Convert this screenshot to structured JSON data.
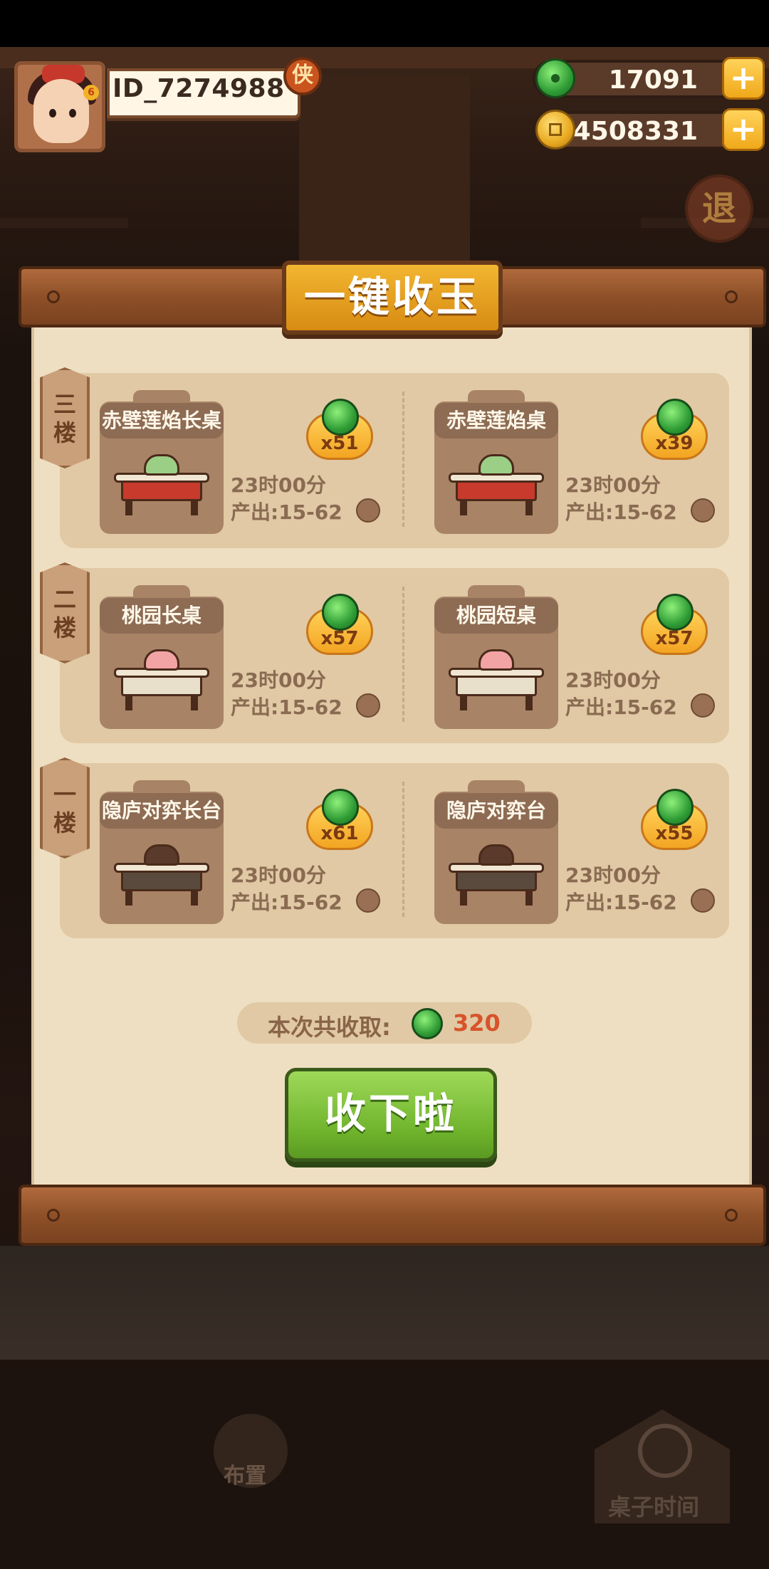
{
  "player": {
    "id_text": "ID_7274988",
    "badge_char": "侠"
  },
  "currencies": [
    {
      "name": "jade",
      "value": "17091",
      "plus": "+"
    },
    {
      "name": "coin",
      "value": "4508331",
      "plus": "+"
    }
  ],
  "exit_char": "退",
  "panel": {
    "title": "一键收玉",
    "floors": [
      {
        "tag": [
          "三",
          "楼"
        ],
        "tables": [
          {
            "name": "赤壁莲焰长桌",
            "count": "x51",
            "time": "23时00分",
            "output": "产出:15-62"
          },
          {
            "name": "赤壁莲焰桌",
            "count": "x39",
            "time": "23时00分",
            "output": "产出:15-62"
          }
        ]
      },
      {
        "tag": [
          "二",
          "楼"
        ],
        "tables": [
          {
            "name": "桃园长桌",
            "count": "x57",
            "time": "23时00分",
            "output": "产出:15-62"
          },
          {
            "name": "桃园短桌",
            "count": "x57",
            "time": "23时00分",
            "output": "产出:15-62"
          }
        ]
      },
      {
        "tag": [
          "一",
          "楼"
        ],
        "tables": [
          {
            "name": "隐庐对弈长台",
            "count": "x61",
            "time": "23时00分",
            "output": "产出:15-62"
          },
          {
            "name": "隐庐对弈台",
            "count": "x55",
            "time": "23时00分",
            "output": "产出:15-62"
          }
        ]
      }
    ],
    "total_label": "本次共收取:",
    "total_value": "320",
    "collect_button": "收下啦"
  },
  "bottom": {
    "layout_label": "布置",
    "table_time_label": "桌子时间"
  },
  "colors": {
    "title_gold": "#f2b631",
    "button_green": "#6fb32c",
    "paper": "#efdfc2",
    "total_value": "#d8532a"
  },
  "icons": [
    "jade-icon",
    "coin-icon",
    "plus-icon",
    "exit-icon",
    "clock-icon",
    "layout-icon"
  ]
}
